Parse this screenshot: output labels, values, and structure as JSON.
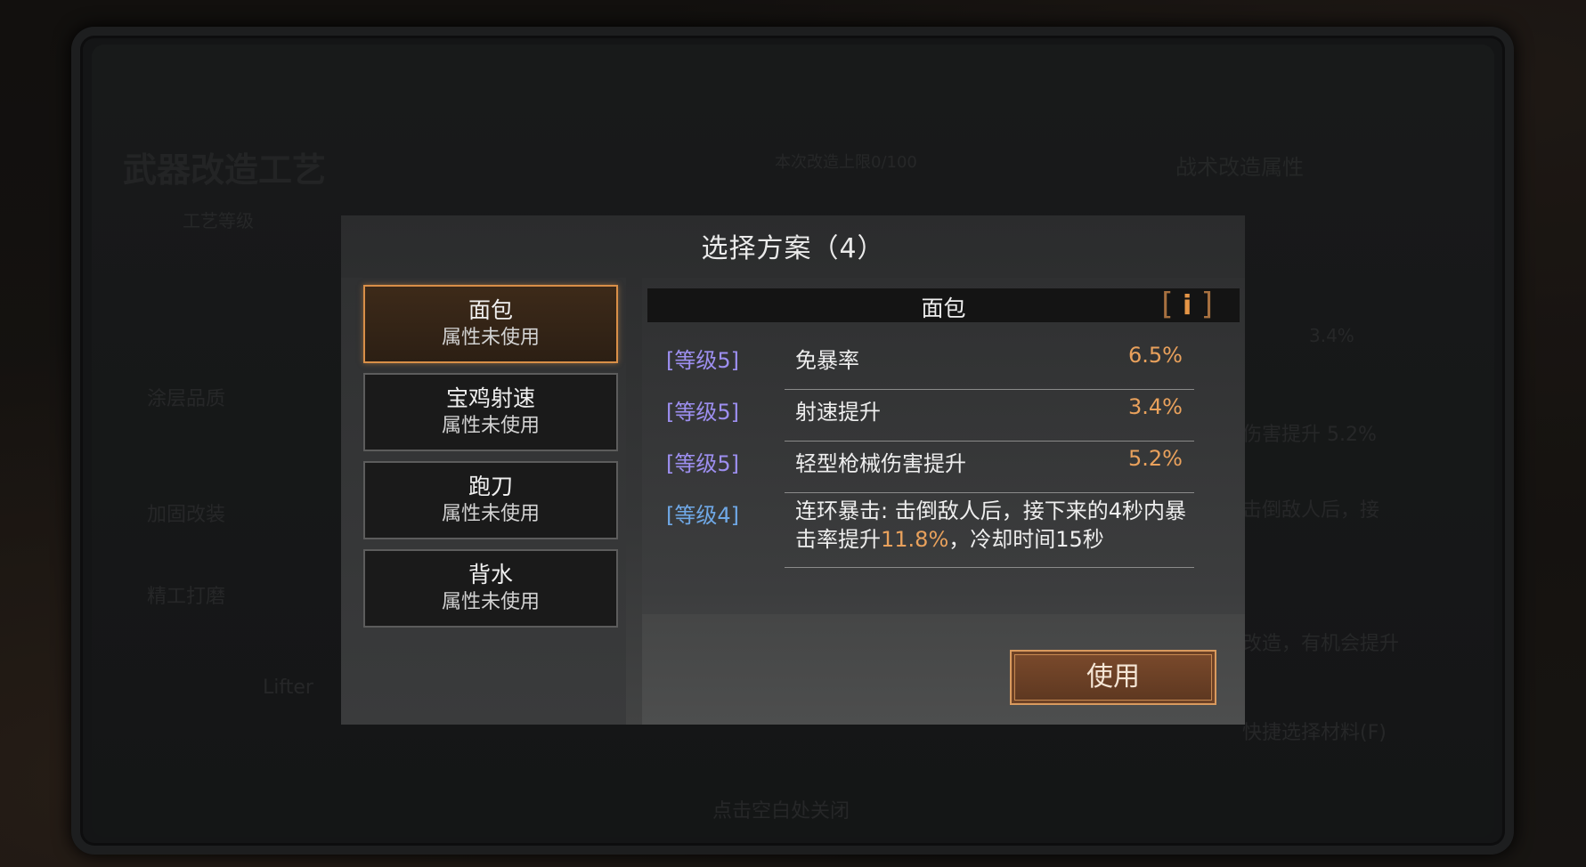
{
  "background": {
    "title": "武器改造工艺",
    "top_info": "本次改造上限0/100",
    "top_link": "战术改造属性",
    "left_label_1": "工艺等级",
    "left_label_2": "涂层品质",
    "left_label_3": "加固改装",
    "left_label_4": "精工打磨",
    "left_label_5": "Lifter",
    "right_value_1": "3.4%",
    "right_label_2": "伤害提升   5.2%",
    "right_label_3": "击倒敌人后，接",
    "right_label_4": "改造，有机会提升",
    "right_label_5": "快捷选择材料(F)",
    "bottom_hint": "点击空白处关闭"
  },
  "modal": {
    "title": "选择方案（4）",
    "schemes": [
      {
        "name": "面包",
        "status": "属性未使用",
        "selected": true
      },
      {
        "name": "宝鸡射速",
        "status": "属性未使用",
        "selected": false
      },
      {
        "name": "跑刀",
        "status": "属性未使用",
        "selected": false
      },
      {
        "name": "背水",
        "status": "属性未使用",
        "selected": false
      }
    ],
    "detail": {
      "title": "面包",
      "info_icon": "i",
      "attributes": [
        {
          "level": "[等级5]",
          "name": "免暴率",
          "value": "6.5%"
        },
        {
          "level": "[等级5]",
          "name": "射速提升",
          "value": "3.4%"
        },
        {
          "level": "[等级5]",
          "name": "轻型枪械伤害提升",
          "value": "5.2%"
        }
      ],
      "special": {
        "level": "[等级4]",
        "desc_part1": "连环暴击: 击倒敌人后，接下来的4秒内暴击率提升",
        "desc_highlight": "11.8%",
        "desc_part2": "，冷却时间15秒"
      }
    },
    "use_button": "使用"
  },
  "colors": {
    "accent_orange": "#e9a15c",
    "level_purple": "#9d8ff0",
    "level_blue": "#6fa8e6",
    "selected_border": "#d98f48"
  }
}
